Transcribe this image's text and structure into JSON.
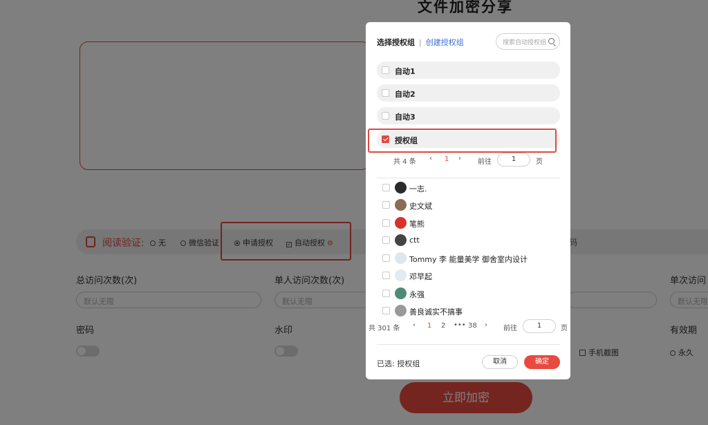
{
  "page": {
    "title": "文件加密分享",
    "verify": {
      "label": "阅读验证:",
      "options": [
        "无",
        "微信验证",
        "申请授权",
        "自动授权"
      ],
      "tail": "码"
    },
    "fields": {
      "total_visits": {
        "label": "总访问次数(次)",
        "placeholder": "默认无限"
      },
      "single_user_visits": {
        "label": "单人访问次数(次)",
        "placeholder": "默认无限"
      },
      "single_visit": {
        "label": "单次访问",
        "placeholder": "默认无限"
      },
      "password_label": "密码",
      "watermark_label": "水印",
      "validity_label": "有效期",
      "screenshot_option": "手机截图",
      "validity_option": "永久"
    },
    "encrypt_button": "立即加密"
  },
  "modal": {
    "title": "选择授权组",
    "create_link": "创建授权组",
    "search_placeholder": "搜索自动授权组",
    "groups": [
      {
        "label": "自动1",
        "checked": false
      },
      {
        "label": "自动2",
        "checked": false
      },
      {
        "label": "自动3",
        "checked": false
      },
      {
        "label": "授权组",
        "checked": true
      }
    ],
    "group_pager": {
      "total": "共 4 条",
      "prev": "‹",
      "current": "1",
      "next": "›",
      "goto": "前往",
      "input": "1",
      "unit": "页"
    },
    "users": [
      {
        "name": "一志.",
        "avatar_color": "#2b2b2b"
      },
      {
        "name": "史文斌",
        "avatar_color": "#8a6d55"
      },
      {
        "name": "笔熊",
        "avatar_color": "#d9322b"
      },
      {
        "name": "ctt",
        "avatar_color": "#444444"
      },
      {
        "name": "Tommy 李 能量美学 御舍室内设计",
        "avatar_color": "#dfe6ec"
      },
      {
        "name": "邓早起",
        "avatar_color": "#e3eaf0"
      },
      {
        "name": "永强",
        "avatar_color": "#4f8a78"
      },
      {
        "name": "善良诚实不搞事",
        "avatar_color": "#9a9a9a"
      }
    ],
    "user_pager": {
      "total": "共 301 条",
      "prev": "‹",
      "p1": "1",
      "p2": "2",
      "ellipsis": "•••",
      "p38": "38",
      "next": "›",
      "goto": "前往",
      "input": "1",
      "unit": "页"
    },
    "selected_label": "已选: 授权组",
    "cancel": "取消",
    "ok": "确定"
  },
  "colors": {
    "accent": "#e84a3f",
    "link": "#3a6fd8"
  }
}
